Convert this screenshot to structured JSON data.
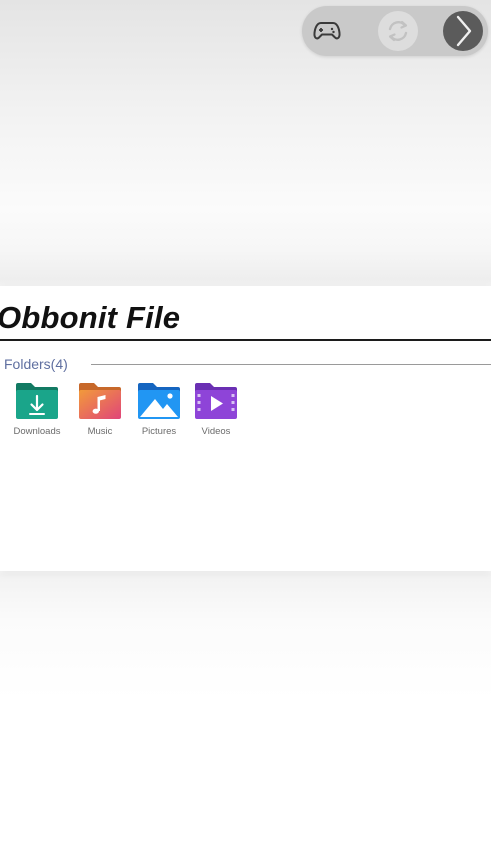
{
  "toolbar": {
    "buttons": [
      {
        "icon": "gamepad-icon"
      },
      {
        "icon": "sync-icon"
      },
      {
        "icon": "chevron-right-icon"
      }
    ]
  },
  "card": {
    "title": "Obbonit File",
    "section_label": "Folders(4)",
    "folders": [
      {
        "label": "Downloads",
        "icon": "download-folder-icon",
        "color": "#1aa58a"
      },
      {
        "label": "Music",
        "icon": "music-folder-icon",
        "color": "#f08a3c"
      },
      {
        "label": "Pictures",
        "icon": "pictures-folder-icon",
        "color": "#1e88e5"
      },
      {
        "label": "Videos",
        "icon": "videos-folder-icon",
        "color": "#8e44d8"
      }
    ]
  }
}
